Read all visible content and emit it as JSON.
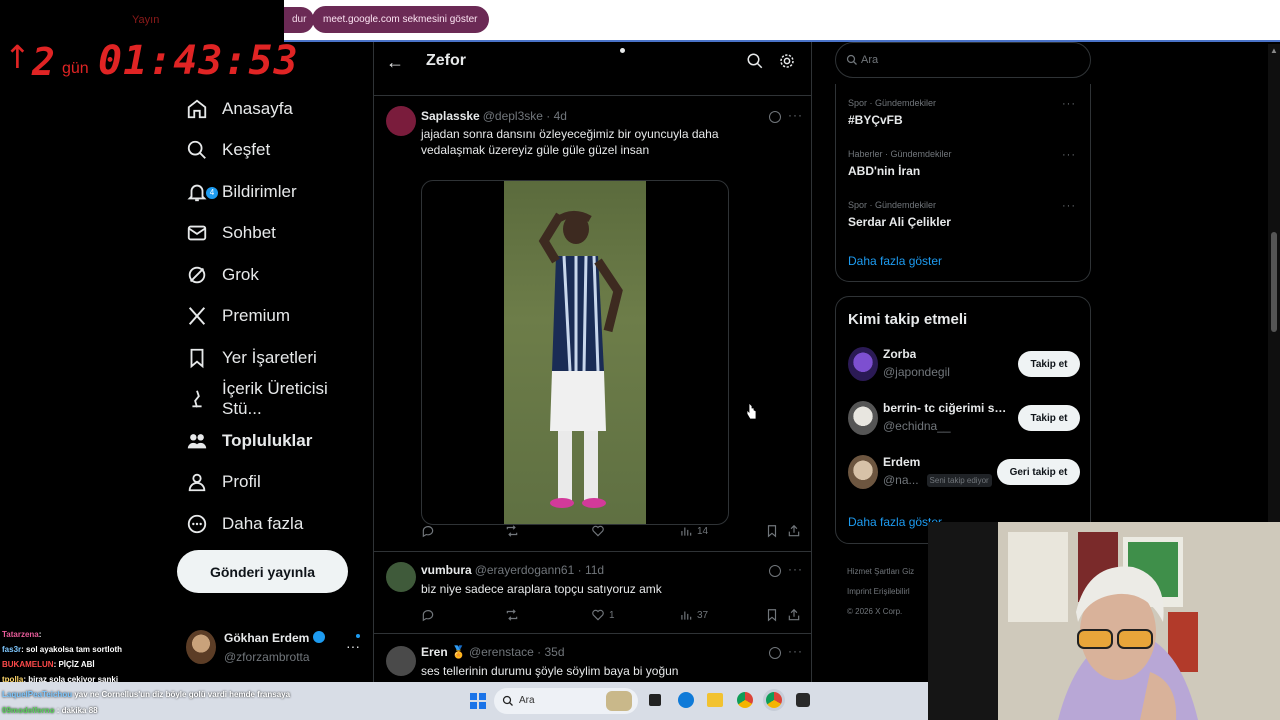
{
  "browser": {
    "pill_partial": "dur",
    "pill_meet": "meet.google.com sekmesini göster"
  },
  "timer": {
    "label": "Yayın",
    "arrow": "↑",
    "days": "2",
    "days_unit": "gün",
    "time": "01:43:53"
  },
  "nav": {
    "items": [
      {
        "label": "Anasayfa",
        "icon": "home-icon"
      },
      {
        "label": "Keşfet",
        "icon": "search-icon"
      },
      {
        "label": "Bildirimler",
        "icon": "bell-icon",
        "badge": "4"
      },
      {
        "label": "Sohbet",
        "icon": "mail-icon"
      },
      {
        "label": "Grok",
        "icon": "grok-icon"
      },
      {
        "label": "Premium",
        "icon": "x-logo-icon"
      },
      {
        "label": "Yer İşaretleri",
        "icon": "bookmark-icon"
      },
      {
        "label": "İçerik Üreticisi Stü...",
        "icon": "creator-icon"
      },
      {
        "label": "Topluluklar",
        "icon": "communities-icon"
      },
      {
        "label": "Profil",
        "icon": "person-icon"
      },
      {
        "label": "Daha fazla",
        "icon": "more-circle-icon"
      }
    ],
    "post_button": "Gönderi yayınla"
  },
  "profile": {
    "name": "Gökhan Erdem",
    "handle": "@zforzambrotta",
    "more": "···"
  },
  "chat": [
    {
      "user": "Tatarzena",
      "text": ": "
    },
    {
      "user": "fas3r",
      "text": ": sol ayakolsa tam sortloth"
    },
    {
      "user": "BUKAMELUN",
      "text": ": PİÇİZ ABİ"
    },
    {
      "user": "tpolla",
      "text": ": biraz sola çekiyor sanki"
    }
  ],
  "taskbar_chat": [
    {
      "user": "LaquelPeaTeichou",
      "text": "yav ne Cornellus'un diz böyle golü vardi hemde fransaya"
    },
    {
      "user": "09modelferno",
      "text": ": dakika 88"
    }
  ],
  "center": {
    "title": "Zefor",
    "tweets": [
      {
        "name": "Saplasske",
        "handle": "@depl3ske · 4d",
        "text": "jajadan sonra dansını özleyeceğimiz bir oyuncuyla daha vedalaşmak üzereyiz güle güle güzel insan",
        "views": "14",
        "more": "···"
      },
      {
        "name": "vumbura",
        "handle": "@erayerdogann61 · 11d",
        "text": "biz niye sadece araplara topçu satıyoruz amk",
        "likes": "1",
        "views": "37",
        "more": "···"
      },
      {
        "name": "Eren 🏅",
        "handle": "@erenstace · 35d",
        "text": "ses tellerinin durumu şöyle söylim baya bi yoğun",
        "more": "···"
      }
    ]
  },
  "right": {
    "search_placeholder": "Ara",
    "trends": [
      {
        "category": "Spor · Gündemdekiler",
        "name": "#BYÇvFB"
      },
      {
        "category": "Haberler · Gündemdekiler",
        "name": "ABD'nin İran"
      },
      {
        "category": "Spor · Gündemdekiler",
        "name": "Serdar Ali Çelikler"
      }
    ],
    "show_more": "Daha fazla göster",
    "follow_title": "Kimi takip etmeli",
    "who_to_follow": [
      {
        "name": "Zorba",
        "handle": "@japondegil",
        "button": "Takip et"
      },
      {
        "name": "berrin- tc ciğerimi so...",
        "handle": "@echidna__",
        "button": "Takip et"
      },
      {
        "name": "Erdem",
        "handle": "@na...",
        "badge": "Seni takip ediyor",
        "button": "Geri takip et"
      }
    ],
    "show_more_2": "Daha fazla göster",
    "footer": [
      "Hizmet Şartları   Giz",
      "Imprint   Erişilebilirl",
      "© 2026 X Corp."
    ]
  },
  "taskbar": {
    "search_placeholder": "Ara"
  },
  "colors": {
    "accent": "#1d9bf0",
    "timer_red": "#e02424",
    "pill_bg": "#6b2a55"
  }
}
